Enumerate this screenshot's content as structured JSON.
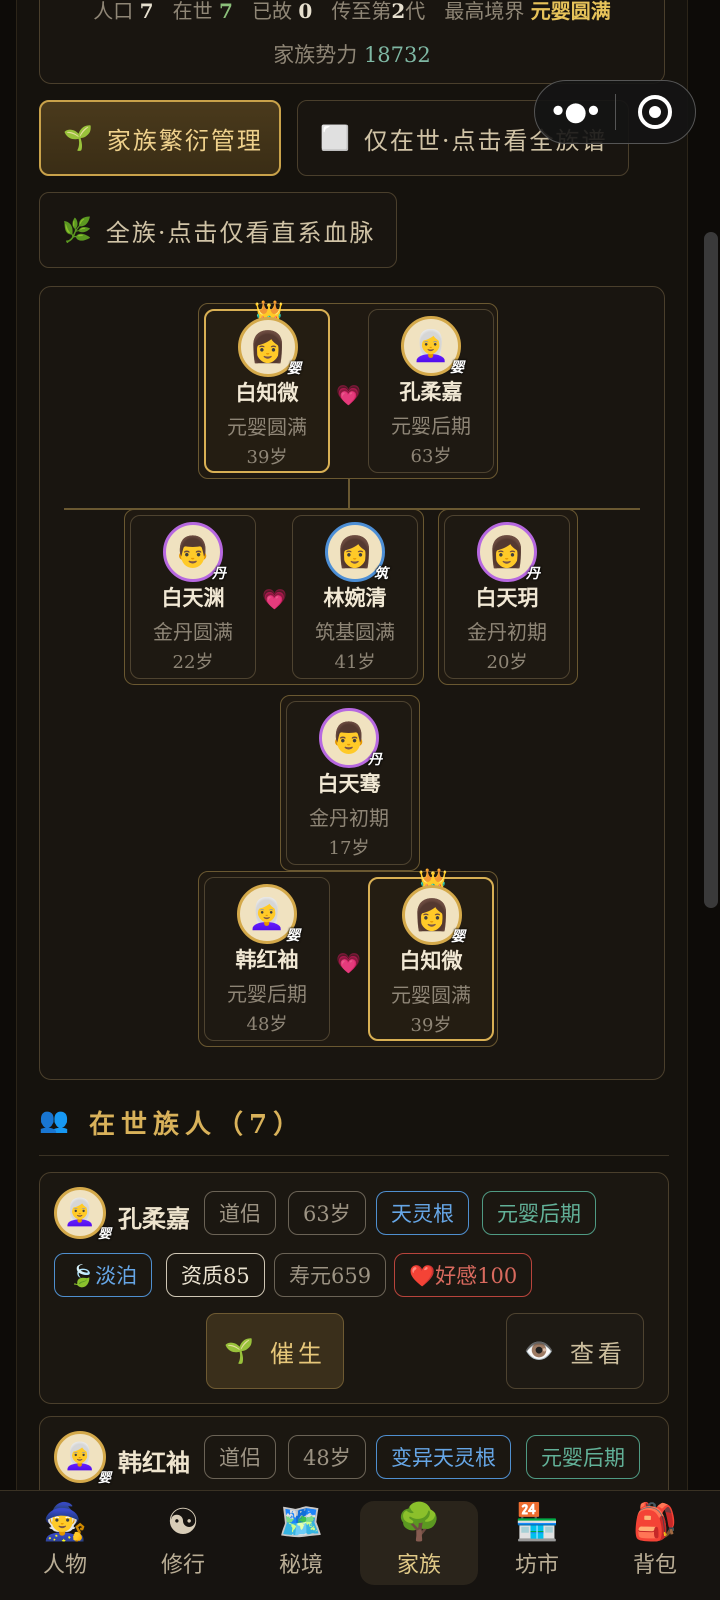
{
  "stats": {
    "population_label": "人口",
    "population": "7",
    "alive_label": "在世",
    "alive": "7",
    "dead_label": "已故",
    "dead": "0",
    "generation_prefix": "传至第",
    "generation": "2",
    "generation_suffix": "代",
    "top_realm_label": "最高境界",
    "top_realm": "元婴圆满",
    "power_label": "家族势力",
    "power": "18732"
  },
  "buttons": {
    "breeding": "家族繁衍管理",
    "alive_only": "仅在世·点击看全族谱",
    "bloodline": "全族·点击仅看直系血脉"
  },
  "tree": {
    "gen1": [
      {
        "name": "白知微",
        "realm": "元婴圆满",
        "age": "39岁",
        "badge": "婴",
        "face": "👩"
      },
      {
        "name": "孔柔嘉",
        "realm": "元婴后期",
        "age": "63岁",
        "badge": "婴",
        "face": "👩‍🦳"
      }
    ],
    "gen2": [
      {
        "name": "白天渊",
        "realm": "金丹圆满",
        "age": "22岁",
        "badge": "丹",
        "face": "👨"
      },
      {
        "name": "林婉清",
        "realm": "筑基圆满",
        "age": "41岁",
        "badge": "筑",
        "face": "👩"
      },
      {
        "name": "白天玥",
        "realm": "金丹初期",
        "age": "20岁",
        "badge": "丹",
        "face": "👩"
      }
    ],
    "gen3": [
      {
        "name": "白天骞",
        "realm": "金丹初期",
        "age": "17岁",
        "badge": "丹",
        "face": "👨"
      }
    ],
    "gen4": [
      {
        "name": "韩红袖",
        "realm": "元婴后期",
        "age": "48岁",
        "badge": "婴",
        "face": "👩‍🦳"
      },
      {
        "name": "白知微",
        "realm": "元婴圆满",
        "age": "39岁",
        "badge": "婴",
        "face": "👩"
      }
    ],
    "crown_icon": "👑",
    "heart_icon": "💗"
  },
  "section": {
    "icon": "👥",
    "title": "在世族人（7）"
  },
  "members": [
    {
      "name": "孔柔嘉",
      "face": "👩‍🦳",
      "badge": "婴",
      "tags": [
        "道侣",
        "63岁",
        "天灵根",
        "元婴后期"
      ],
      "tags2": [
        "🍃淡泊",
        "资质85",
        "寿元659",
        "❤️好感100"
      ],
      "action_breed": "催生",
      "action_view": "查看"
    },
    {
      "name": "韩红袖",
      "face": "👩‍🦳",
      "badge": "婴",
      "tags": [
        "道侣",
        "48岁",
        "变异天灵根",
        "元婴后期"
      ]
    }
  ],
  "action_icons": {
    "breed": "🌱",
    "view": "👁️"
  },
  "nav": [
    {
      "label": "人物",
      "icon": "🧙"
    },
    {
      "label": "修行",
      "icon": "☯"
    },
    {
      "label": "秘境",
      "icon": "🗺️"
    },
    {
      "label": "家族",
      "icon": "🌳"
    },
    {
      "label": "坊市",
      "icon": "🏪"
    },
    {
      "label": "背包",
      "icon": "🎒"
    }
  ],
  "colors": {
    "gold": "#d9b054",
    "accent_green": "#8bbf7a",
    "power_teal": "#7fb8a4",
    "purple_ring": "#b768e0",
    "blue_ring": "#4d8fd6"
  }
}
